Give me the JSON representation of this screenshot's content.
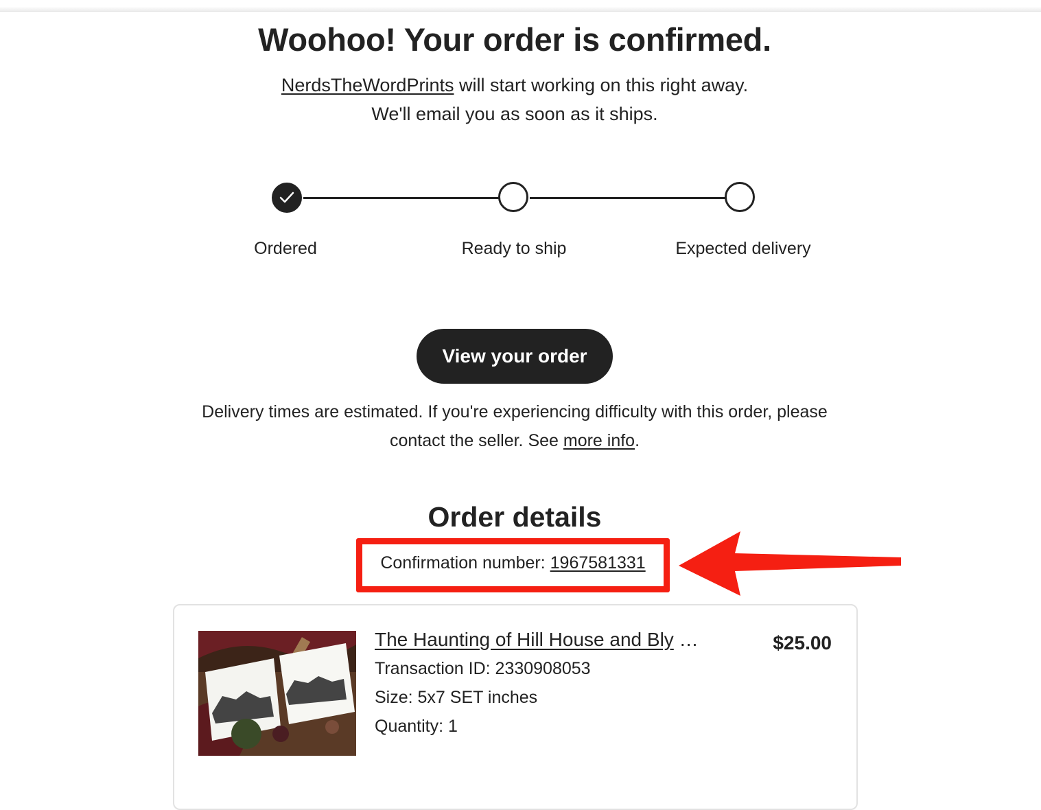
{
  "confirmation_page": {
    "headline": "Woohoo! Your order is confirmed.",
    "shop_name": "NerdsTheWordPrints",
    "subline_rest": " will start working on this right away.",
    "subline_2": "We'll email you as soon as it ships."
  },
  "progress": {
    "steps": [
      {
        "label": "Ordered",
        "state": "complete"
      },
      {
        "label": "Ready to ship",
        "state": "pending"
      },
      {
        "label": "Expected delivery",
        "state": "pending"
      }
    ]
  },
  "actions": {
    "view_order_label": "View your order"
  },
  "delivery_note": {
    "line_1": "Delivery times are estimated. If you're experiencing difficulty with this order, please",
    "line_2_prefix": "contact the seller. See ",
    "more_info_link": "more info",
    "line_2_suffix": "."
  },
  "order_details": {
    "heading": "Order details",
    "confirmation_label": "Confirmation number: ",
    "confirmation_number": "1967581331",
    "items": [
      {
        "title": "The Haunting of Hill House and Bly",
        "ellipsis": " …",
        "price": "$25.00",
        "transaction": "Transaction ID: 2330908053",
        "size": "Size: 5x7 SET inches",
        "quantity": "Quantity: 1"
      }
    ]
  },
  "colors": {
    "accent_dark": "#222222",
    "annotation_red": "#f51f12"
  },
  "icons": {
    "completed_step": "checkmark-icon",
    "annotation": "red-arrow-annotation"
  }
}
